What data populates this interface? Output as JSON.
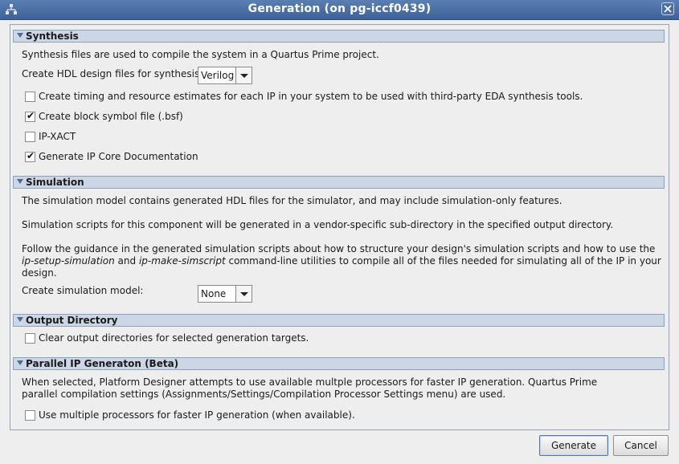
{
  "window": {
    "title": "Generation (on pg-iccf0439)"
  },
  "synthesis": {
    "header": "Synthesis",
    "description": "Synthesis files are used to compile the system in a Quartus Prime project.",
    "hdl_label": "Create HDL design files for synthesis:",
    "hdl_value": "Verilog",
    "options": [
      {
        "label": "Create timing and resource estimates for each IP in your system to be used with third-party EDA synthesis tools.",
        "checked": false
      },
      {
        "label": "Create block symbol file (.bsf)",
        "checked": true
      },
      {
        "label": "IP-XACT",
        "checked": false
      },
      {
        "label": "Generate IP Core Documentation",
        "checked": true
      }
    ]
  },
  "simulation": {
    "header": "Simulation",
    "desc1": "The simulation model contains generated HDL files for the simulator, and may include simulation-only features.",
    "desc2": "Simulation scripts for this component will be generated in a vendor-specific sub-directory in the specified output directory.",
    "desc3_a": "Follow the guidance in the generated simulation scripts about how to structure your design's simulation scripts and how to use the",
    "desc3_b_em1": "ip-setup-simulation",
    "desc3_b_and": " and ",
    "desc3_b_em2": "ip-make-simscript",
    "desc3_b_rest": " command-line utilities to compile all of the files needed for simulating all of the IP in your",
    "desc3_c": "design.",
    "model_label": "Create simulation model:",
    "model_value": "None"
  },
  "output_directory": {
    "header": "Output Directory",
    "option": {
      "label": "Clear output directories for selected generation targets.",
      "checked": false
    }
  },
  "parallel": {
    "header": "Parallel IP Generaton (Beta)",
    "desc1": "When selected, Platform Designer attempts to use available multple processors for faster IP generation. Quartus Prime",
    "desc2": "parallel compilation settings (Assignments/Settings/Compilation Processor Settings menu) are used.",
    "option": {
      "label": "Use multiple processors for faster IP generation (when available).",
      "checked": false
    }
  },
  "buttons": {
    "generate": "Generate",
    "cancel": "Cancel"
  },
  "icons": {
    "checkmark": "✔"
  }
}
